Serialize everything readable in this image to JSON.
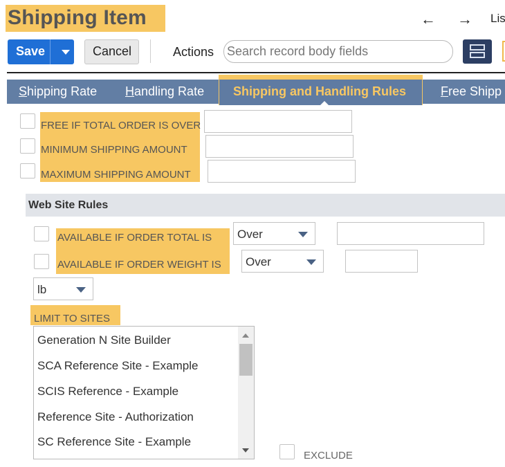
{
  "header": {
    "title": "Shipping Item",
    "back_icon": "left-arrow-icon",
    "forward_icon": "right-arrow-icon",
    "list_label": "Lis"
  },
  "toolbar": {
    "save_label": "Save",
    "cancel_label": "Cancel",
    "actions_label": "Actions",
    "search_placeholder": "Search record body fields",
    "search_value": ""
  },
  "tabs": [
    {
      "label": "Shipping Rate",
      "first": "S",
      "rest": "hipping Rate"
    },
    {
      "label": "Handling Rate",
      "first": "H",
      "rest": "andling Rate"
    },
    {
      "label": "Shipping and Handling Rules",
      "active": true
    },
    {
      "label": "Free Shipp",
      "first": "F",
      "rest": "ree Shipp"
    }
  ],
  "shipping_fields": [
    {
      "label": "FREE IF TOTAL ORDER IS OVER",
      "checked": false,
      "value": ""
    },
    {
      "label": "MINIMUM SHIPPING AMOUNT",
      "checked": false,
      "value": ""
    },
    {
      "label": "MAXIMUM SHIPPING AMOUNT",
      "checked": false,
      "value": ""
    }
  ],
  "web_site_rules": {
    "title": "Web Site Rules",
    "order_total": {
      "label": "AVAILABLE IF ORDER TOTAL IS",
      "checked": false,
      "operator": "Over",
      "value": ""
    },
    "order_weight": {
      "label": "AVAILABLE IF ORDER WEIGHT IS",
      "checked": false,
      "operator": "Over",
      "value": ""
    },
    "weight_unit": "lb",
    "limit_to_sites_label": "LIMIT TO SITES",
    "sites": [
      "Generation N Site Builder",
      "SCA Reference Site - Example",
      "SCIS Reference - Example",
      "Reference Site - Authorization",
      "SC Reference Site - Example"
    ],
    "exclude_label": "EXCLUDE",
    "exclude_checked": false
  },
  "colors": {
    "highlight": "#f7c762",
    "save_blue": "#1f6fd6",
    "tab_bar": "#627ea4",
    "layout_button": "#2c3e63"
  }
}
